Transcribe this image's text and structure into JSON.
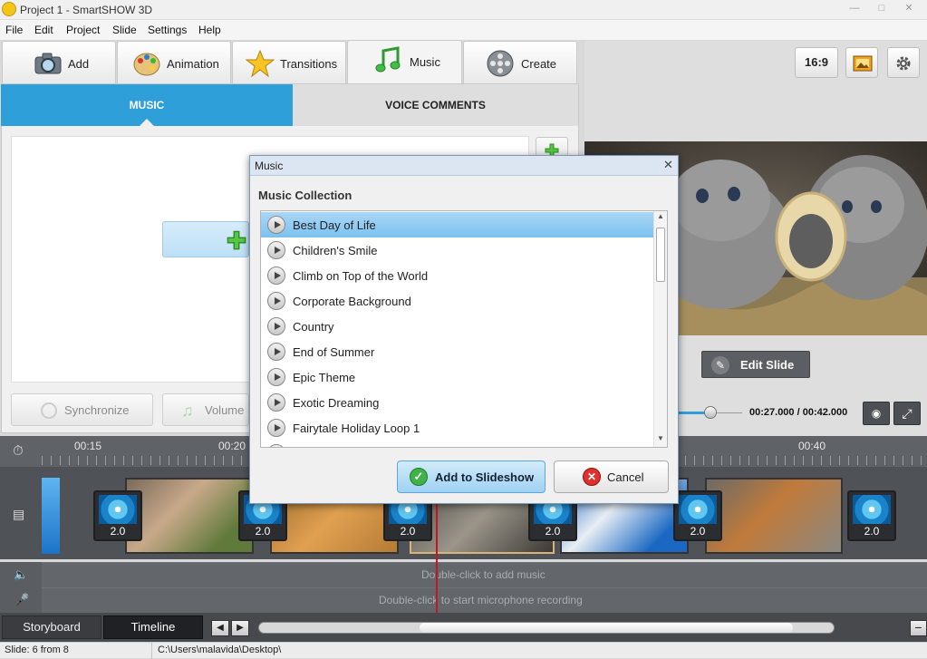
{
  "window": {
    "title": "Project 1 - SmartSHOW 3D"
  },
  "menu": [
    "File",
    "Edit",
    "Project",
    "Slide",
    "Settings",
    "Help"
  ],
  "tabs": [
    {
      "label": "Add",
      "icon": "camera-icon"
    },
    {
      "label": "Animation",
      "icon": "palette-icon"
    },
    {
      "label": "Transitions",
      "icon": "star-icon"
    },
    {
      "label": "Music",
      "icon": "music-note-icon",
      "active": true
    },
    {
      "label": "Create",
      "icon": "film-reel-icon"
    }
  ],
  "subtabs": {
    "music": "MUSIC",
    "voice": "VOICE COMMENTS"
  },
  "left_buttons": {
    "synchronize": "Synchronize",
    "volume": "Volume"
  },
  "preview": {
    "aspect_ratio": "16:9",
    "edit_slide": "Edit Slide",
    "time": "00:27.000 / 00:42.000"
  },
  "ruler": {
    "labels": [
      "00:15",
      "00:20",
      "00:40"
    ]
  },
  "timeline": {
    "transitions": [
      "2.0",
      "2.0",
      "2.0",
      "2.0",
      "2.0",
      "2.0"
    ],
    "audio_hint": "Double-click to add music",
    "mic_hint": "Double-click to start microphone recording"
  },
  "bottom": {
    "storyboard": "Storyboard",
    "timeline": "Timeline"
  },
  "status": {
    "slide": "Slide: 6 from 8",
    "path": "C:\\Users\\malavida\\Desktop\\"
  },
  "dialog": {
    "title": "Music",
    "heading": "Music Collection",
    "songs": [
      "Best Day of Life",
      "Children's Smile",
      "Climb on Top of the World",
      "Corporate Background",
      "Country",
      "End of Summer",
      "Epic Theme",
      "Exotic Dreaming",
      "Fairytale Holiday Loop 1"
    ],
    "selected_index": 0,
    "add_button": "Add to Slideshow",
    "cancel_button": "Cancel"
  },
  "colors": {
    "accent": "#2e9fd8",
    "selection": "#7cc1ef",
    "playhead": "#c0181e"
  }
}
